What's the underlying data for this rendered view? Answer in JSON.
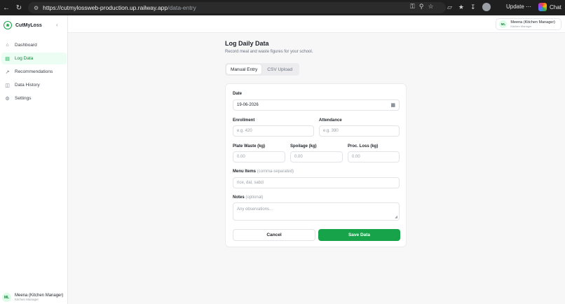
{
  "browser": {
    "url_host": "https://cutmylossweb-production.up.railway.app",
    "url_path": "/data-entry",
    "update_label": "Update",
    "chat_label": "Chat"
  },
  "sidebar": {
    "brand": "CutMyLoss",
    "items": [
      {
        "label": "Dashboard",
        "icon": "home-icon"
      },
      {
        "label": "Log Data",
        "icon": "clipboard-icon"
      },
      {
        "label": "Recommendations",
        "icon": "trend-icon"
      },
      {
        "label": "Data History",
        "icon": "book-icon"
      },
      {
        "label": "Settings",
        "icon": "gear-icon"
      }
    ],
    "user_initials": "ML",
    "user_name": "Meena (Kitchen Manager)",
    "user_role": "Kitchen Manager"
  },
  "topbar": {
    "user_initials": "ML",
    "user_name": "Meena (Kitchen Manager)",
    "user_role": "Kitchen Manager"
  },
  "main": {
    "title": "Log Daily Data",
    "subtitle": "Record meal and waste figures for your school.",
    "tabs": [
      "Manual Entry",
      "CSV Upload"
    ],
    "form": {
      "date_label": "Date",
      "date_value": "19-06-2026",
      "enrollment_label": "Enrollment",
      "enrollment_placeholder": "e.g. 420",
      "attendance_label": "Attendance",
      "attendance_placeholder": "e.g. 390",
      "plate_waste_label": "Plate Waste (kg)",
      "plate_waste_placeholder": "0.00",
      "spoilage_label": "Spoilage (kg)",
      "spoilage_placeholder": "0.00",
      "proc_loss_label": "Proc. Loss (kg)",
      "proc_loss_placeholder": "0.00",
      "menu_items_label": "Menu Items",
      "menu_items_hint": "(comma-separated)",
      "menu_items_placeholder": "rice, dal, sabzi",
      "notes_label": "Notes",
      "notes_hint": "(optional)",
      "notes_placeholder": "Any observations...",
      "cancel_label": "Cancel",
      "save_label": "Save Data"
    }
  },
  "colors": {
    "accent": "#16a34a",
    "active_bg": "#ecfdf3"
  }
}
